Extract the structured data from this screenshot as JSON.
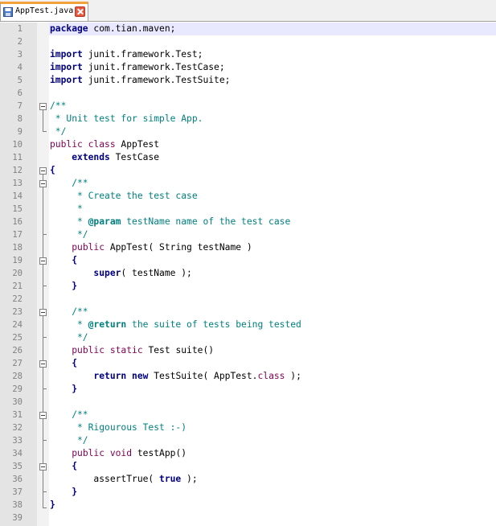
{
  "tab": {
    "title": "AppTest.java",
    "accent": "#f3a23b"
  },
  "colors": {
    "keyword": "#7f0055",
    "comment": "#008080",
    "gutter": "#e4e4e4",
    "current_line": "#e8e8ff"
  },
  "lines": [
    {
      "n": "1",
      "parts": [
        {
          "t": "package",
          "c": "kw2"
        },
        {
          "t": " com.tian.maven;",
          "c": ""
        }
      ]
    },
    {
      "n": "2",
      "parts": []
    },
    {
      "n": "3",
      "parts": [
        {
          "t": "import",
          "c": "kw2"
        },
        {
          "t": " junit.framework.Test;",
          "c": ""
        }
      ]
    },
    {
      "n": "4",
      "parts": [
        {
          "t": "import",
          "c": "kw2"
        },
        {
          "t": " junit.framework.TestCase;",
          "c": ""
        }
      ]
    },
    {
      "n": "5",
      "parts": [
        {
          "t": "import",
          "c": "kw2"
        },
        {
          "t": " junit.framework.TestSuite;",
          "c": ""
        }
      ]
    },
    {
      "n": "6",
      "parts": []
    },
    {
      "n": "7",
      "parts": [
        {
          "t": "/**",
          "c": "cm"
        }
      ]
    },
    {
      "n": "8",
      "parts": [
        {
          "t": " * Unit test for simple App.",
          "c": "cm"
        }
      ]
    },
    {
      "n": "9",
      "parts": [
        {
          "t": " */",
          "c": "cm"
        }
      ]
    },
    {
      "n": "10",
      "parts": [
        {
          "t": "public class",
          "c": "kw"
        },
        {
          "t": " AppTest",
          "c": ""
        }
      ]
    },
    {
      "n": "11",
      "parts": [
        {
          "t": "    ",
          "c": ""
        },
        {
          "t": "extends",
          "c": "kw2"
        },
        {
          "t": " TestCase",
          "c": ""
        }
      ]
    },
    {
      "n": "12",
      "parts": [
        {
          "t": "{",
          "c": "br"
        }
      ]
    },
    {
      "n": "13",
      "parts": [
        {
          "t": "    /**",
          "c": "cm"
        }
      ]
    },
    {
      "n": "14",
      "parts": [
        {
          "t": "     * Create the test case",
          "c": "cm"
        }
      ]
    },
    {
      "n": "15",
      "parts": [
        {
          "t": "     *",
          "c": "cm"
        }
      ]
    },
    {
      "n": "16",
      "parts": [
        {
          "t": "     * ",
          "c": "cm"
        },
        {
          "t": "@param",
          "c": "cmtag"
        },
        {
          "t": " testName name of the test case",
          "c": "cm"
        }
      ]
    },
    {
      "n": "17",
      "parts": [
        {
          "t": "     */",
          "c": "cm"
        }
      ]
    },
    {
      "n": "18",
      "parts": [
        {
          "t": "    ",
          "c": ""
        },
        {
          "t": "public",
          "c": "kw"
        },
        {
          "t": " AppTest( String testName )",
          "c": ""
        }
      ]
    },
    {
      "n": "19",
      "parts": [
        {
          "t": "    {",
          "c": "br"
        }
      ]
    },
    {
      "n": "20",
      "parts": [
        {
          "t": "        ",
          "c": ""
        },
        {
          "t": "super",
          "c": "kw2"
        },
        {
          "t": "( testName );",
          "c": ""
        }
      ]
    },
    {
      "n": "21",
      "parts": [
        {
          "t": "    }",
          "c": "br"
        }
      ]
    },
    {
      "n": "22",
      "parts": []
    },
    {
      "n": "23",
      "parts": [
        {
          "t": "    /**",
          "c": "cm"
        }
      ]
    },
    {
      "n": "24",
      "parts": [
        {
          "t": "     * ",
          "c": "cm"
        },
        {
          "t": "@return",
          "c": "cmtag"
        },
        {
          "t": " the suite of tests being tested",
          "c": "cm"
        }
      ]
    },
    {
      "n": "25",
      "parts": [
        {
          "t": "     */",
          "c": "cm"
        }
      ]
    },
    {
      "n": "26",
      "parts": [
        {
          "t": "    ",
          "c": ""
        },
        {
          "t": "public static",
          "c": "kw"
        },
        {
          "t": " Test suite()",
          "c": ""
        }
      ]
    },
    {
      "n": "27",
      "parts": [
        {
          "t": "    {",
          "c": "br"
        }
      ]
    },
    {
      "n": "28",
      "parts": [
        {
          "t": "        ",
          "c": ""
        },
        {
          "t": "return new",
          "c": "kw2"
        },
        {
          "t": " TestSuite( AppTest.",
          "c": ""
        },
        {
          "t": "class",
          "c": "kw"
        },
        {
          "t": " );",
          "c": ""
        }
      ]
    },
    {
      "n": "29",
      "parts": [
        {
          "t": "    }",
          "c": "br"
        }
      ]
    },
    {
      "n": "30",
      "parts": []
    },
    {
      "n": "31",
      "parts": [
        {
          "t": "    /**",
          "c": "cm"
        }
      ]
    },
    {
      "n": "32",
      "parts": [
        {
          "t": "     * Rigourous Test :-)",
          "c": "cm"
        }
      ]
    },
    {
      "n": "33",
      "parts": [
        {
          "t": "     */",
          "c": "cm"
        }
      ]
    },
    {
      "n": "34",
      "parts": [
        {
          "t": "    ",
          "c": ""
        },
        {
          "t": "public void",
          "c": "kw"
        },
        {
          "t": " testApp()",
          "c": ""
        }
      ]
    },
    {
      "n": "35",
      "parts": [
        {
          "t": "    {",
          "c": "br"
        }
      ]
    },
    {
      "n": "36",
      "parts": [
        {
          "t": "        assertTrue( ",
          "c": ""
        },
        {
          "t": "true",
          "c": "kw2"
        },
        {
          "t": " );",
          "c": ""
        }
      ]
    },
    {
      "n": "37",
      "parts": [
        {
          "t": "    }",
          "c": "br"
        }
      ]
    },
    {
      "n": "38",
      "parts": [
        {
          "t": "}",
          "c": "br"
        }
      ]
    },
    {
      "n": "39",
      "parts": []
    }
  ]
}
